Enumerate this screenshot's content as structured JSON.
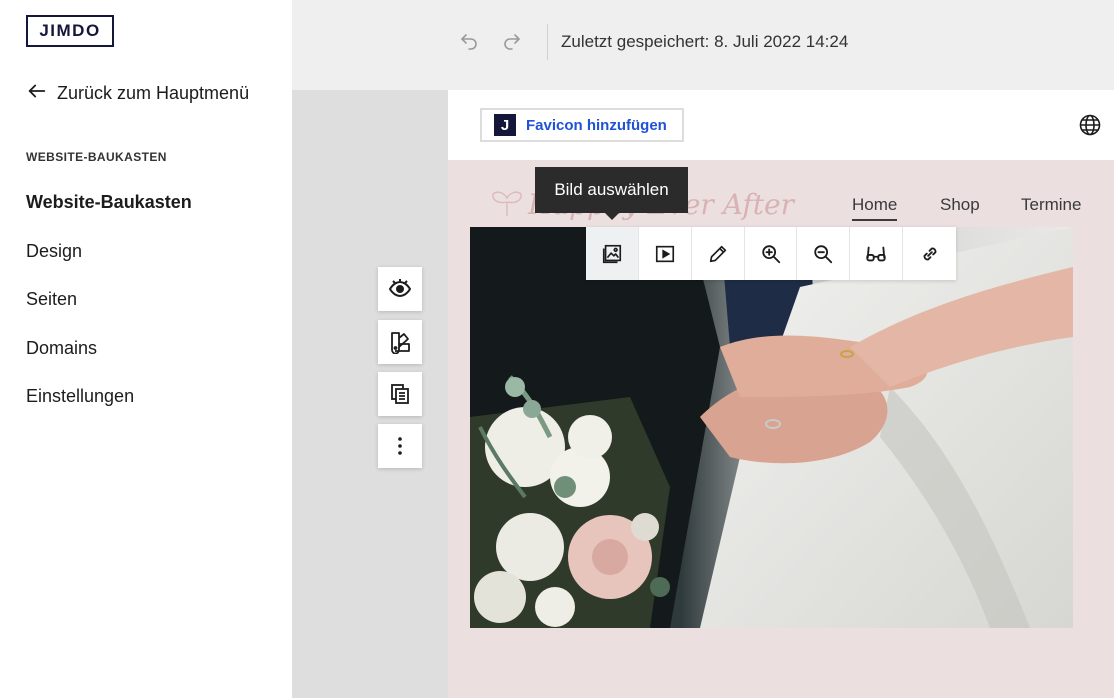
{
  "brand": {
    "logo_text": "JIMDO"
  },
  "sidebar": {
    "back_label": "Zurück zum Hauptmenü",
    "section_title": "WEBSITE-BAUKASTEN",
    "items": [
      {
        "label": "Website-Baukasten",
        "active": true
      },
      {
        "label": "Design"
      },
      {
        "label": "Seiten"
      },
      {
        "label": "Domains"
      },
      {
        "label": "Einstellungen"
      }
    ]
  },
  "topbar": {
    "undo_icon": "undo-icon",
    "redo_icon": "redo-icon",
    "saved_text": "Zuletzt gespeichert: 8. Juli 2022 14:24"
  },
  "site_header": {
    "favicon_badge": "J",
    "favicon_label": "Favicon hinzufügen",
    "globe_icon": "globe-icon"
  },
  "site": {
    "logo_text": "Happily Ever After",
    "nav": [
      "Home",
      "Shop",
      "Termine"
    ],
    "active_nav": "Home"
  },
  "tooltip": {
    "text": "Bild auswählen"
  },
  "image_toolbar": {
    "buttons": [
      "select-image-icon",
      "video-icon",
      "edit-pencil-icon",
      "zoom-in-icon",
      "zoom-out-icon",
      "glasses-icon",
      "link-icon"
    ]
  },
  "side_tools": [
    "eye-icon",
    "paint-swatch-icon",
    "copy-icon",
    "more-vertical-icon"
  ],
  "colors": {
    "brand_navy": "#15173a",
    "link_blue": "#1f52d6",
    "site_background": "#ebdfe0",
    "tooltip_bg": "#2b2b2b"
  }
}
